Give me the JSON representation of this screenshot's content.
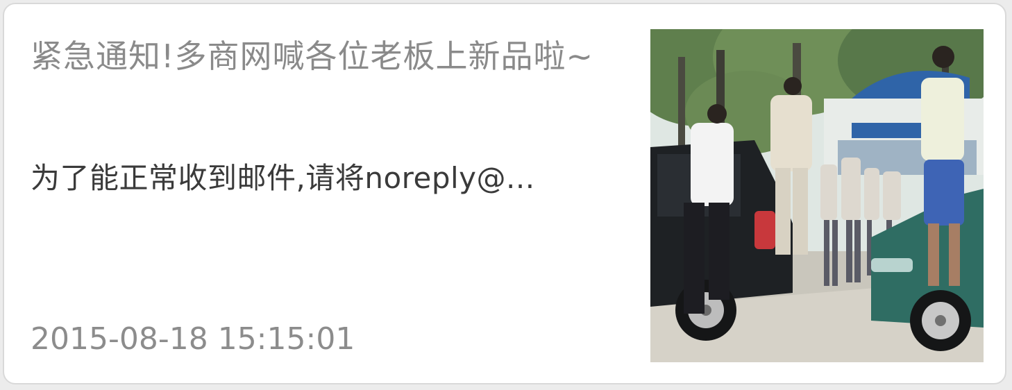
{
  "notification": {
    "title": "紧急通知!多商网喊各位老板上新品啦~",
    "summary": "为了能正常收到邮件,请将noreply@...",
    "timestamp": "2015-08-18 15:15:01"
  },
  "thumbnail": {
    "icon": "news-photo",
    "colors": {
      "sky": "#dfe7e3",
      "foliage": "#5f7f4d",
      "pavement": "#c9c6bc",
      "black_car": "#1e2124",
      "green_car": "#2f6d63",
      "blue_sign": "#2f64a8"
    }
  }
}
